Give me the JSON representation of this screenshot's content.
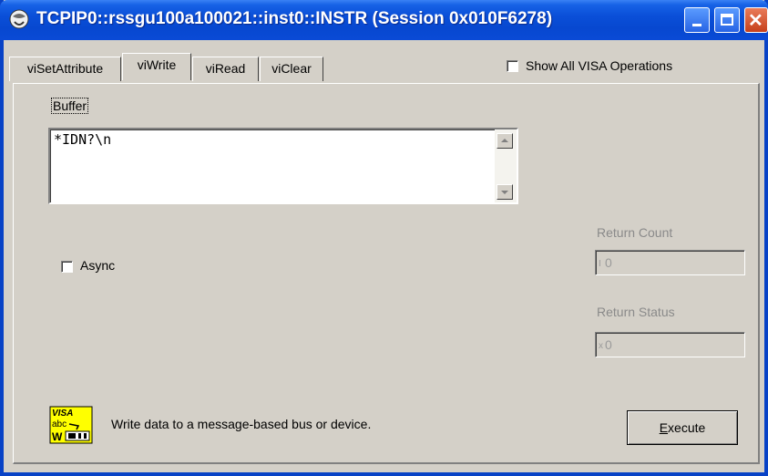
{
  "window": {
    "title": "TCPIP0::rssgu100a100021::inst0::INSTR (Session 0x010F6278)"
  },
  "tabs": [
    {
      "label": "viSetAttribute"
    },
    {
      "label": "viWrite"
    },
    {
      "label": "viRead"
    },
    {
      "label": "viClear"
    }
  ],
  "show_all": {
    "label": "Show All VISA Operations",
    "checked": false
  },
  "buffer": {
    "label": "Buffer",
    "value": "*IDN?\\n"
  },
  "async": {
    "label": "Async",
    "checked": false
  },
  "return_count": {
    "label": "Return Count",
    "value": "0",
    "prefix": "I"
  },
  "return_status": {
    "label": "Return Status",
    "value": "0",
    "prefix": "x"
  },
  "description": "Write data to a message-based bus or device.",
  "execute": {
    "label_first": "E",
    "label_rest": "xecute"
  },
  "icon_text": {
    "line1": "VISA",
    "line2": "abc",
    "line3": "W"
  }
}
